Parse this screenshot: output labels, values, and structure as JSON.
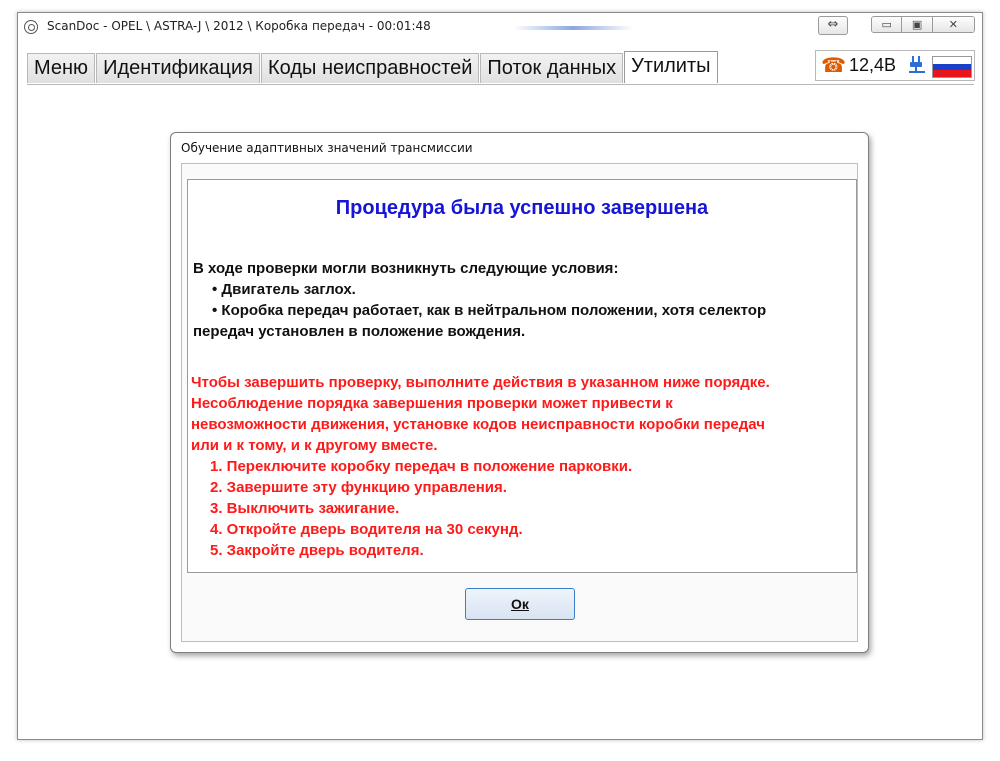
{
  "window": {
    "title": "ScanDoc - OPEL \\ ASTRA-J \\ 2012 \\ Коробка передач - 00:01:48",
    "resize_icon": "⇔",
    "minimize_icon": "▭",
    "maximize_icon": "▣",
    "close_icon": "✕"
  },
  "tabs": [
    {
      "label": "Меню"
    },
    {
      "label": "Идентификация"
    },
    {
      "label": "Коды неисправностей"
    },
    {
      "label": "Поток данных"
    },
    {
      "label": "Утилиты",
      "active": true
    }
  ],
  "status": {
    "phone_icon": "☎",
    "voltage": "12,4В",
    "plug_icon": "plug-icon",
    "flag_colors": [
      "#ffffff",
      "#1a3fc9",
      "#e8141b"
    ]
  },
  "dialog": {
    "title": "Обучение адаптивных значений трансмиссии",
    "heading": "Процедура была успешно завершена",
    "conditions_intro": "В ходе проверки могли возникнуть следующие условия:",
    "conditions": [
      "• Двигатель заглох.",
      "• Коробка передач работает, как в нейтральном положении, хотя селектор"
    ],
    "conditions_cont": "передач установлен в положение вождения.",
    "warning": [
      "Чтобы завершить проверку, выполните действия в указанном ниже порядке.",
      "Несоблюдение порядка завершения проверки может привести к",
      "невозможности движения, установке кодов неисправности коробки передач",
      "или и к тому, и к другому вместе."
    ],
    "steps": [
      "1. Переключите коробку передач в положение парковки.",
      "2. Завершите эту функцию управления.",
      "3. Выключить зажигание.",
      "4. Откройте дверь водителя на 30 секунд.",
      "5. Закройте дверь водителя."
    ],
    "ok_label": "Ок"
  },
  "colors": {
    "heading": "#1515d8",
    "warning": "#ff1a1a",
    "accent_border": "#3a7ec9"
  }
}
